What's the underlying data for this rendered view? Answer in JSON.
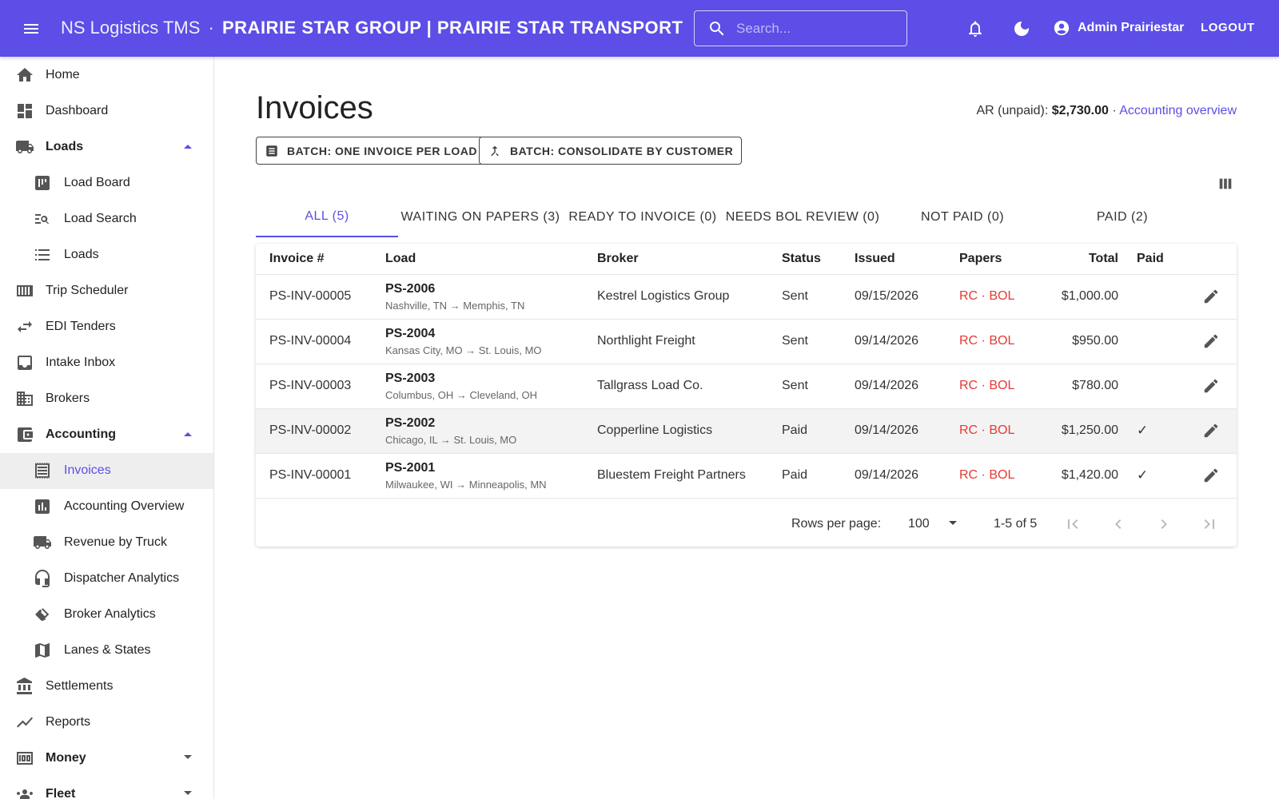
{
  "appbar": {
    "app_name": "NS Logistics TMS",
    "separator": "·",
    "org_name": "PRAIRIE STAR GROUP | PRAIRIE STAR TRANSPORT",
    "search_placeholder": "Search...",
    "user_name": "Admin Prairiestar",
    "logout_label": "LOGOUT"
  },
  "sidebar": {
    "items": [
      {
        "label": "Home",
        "icon": "home-icon"
      },
      {
        "label": "Dashboard",
        "icon": "dashboard-icon"
      },
      {
        "label": "Loads",
        "icon": "truck-icon",
        "expanded": true
      },
      {
        "label": "Load Board",
        "icon": "board-icon"
      },
      {
        "label": "Load Search",
        "icon": "search-list-icon"
      },
      {
        "label": "Loads",
        "icon": "list-icon"
      },
      {
        "label": "Trip Scheduler",
        "icon": "columns-icon"
      },
      {
        "label": "EDI Tenders",
        "icon": "swap-icon"
      },
      {
        "label": "Intake Inbox",
        "icon": "inbox-icon"
      },
      {
        "label": "Brokers",
        "icon": "building-icon"
      },
      {
        "label": "Accounting",
        "icon": "wallet-icon",
        "expanded": true
      },
      {
        "label": "Invoices",
        "icon": "receipt-icon",
        "active": true
      },
      {
        "label": "Accounting Overview",
        "icon": "bar-chart-icon"
      },
      {
        "label": "Revenue by Truck",
        "icon": "truck-icon"
      },
      {
        "label": "Dispatcher Analytics",
        "icon": "headset-icon"
      },
      {
        "label": "Broker Analytics",
        "icon": "handshake-icon"
      },
      {
        "label": "Lanes & States",
        "icon": "map-icon"
      },
      {
        "label": "Settlements",
        "icon": "bank-icon"
      },
      {
        "label": "Reports",
        "icon": "trend-icon"
      },
      {
        "label": "Money",
        "icon": "money-icon",
        "expanded": false
      },
      {
        "label": "Fleet",
        "icon": "people-icon",
        "expanded": false
      }
    ]
  },
  "main": {
    "title": "Invoices",
    "ar_label": "AR (unpaid):",
    "ar_value": "$2,730.00",
    "ar_sep": "·",
    "ar_link": "Accounting overview",
    "batch_one_label": "BATCH: ONE INVOICE PER LOAD",
    "batch_consolidate_label": "BATCH: CONSOLIDATE BY CUSTOMER",
    "tabs": [
      {
        "label": "ALL (5)",
        "active": true
      },
      {
        "label": "WAITING ON PAPERS (3)"
      },
      {
        "label": "READY TO INVOICE (0)"
      },
      {
        "label": "NEEDS BOL REVIEW (0)"
      },
      {
        "label": "NOT PAID (0)"
      },
      {
        "label": "PAID (2)"
      }
    ],
    "columns": [
      "Invoice #",
      "Load",
      "Broker",
      "Status",
      "Issued",
      "Papers",
      "Total",
      "Paid"
    ],
    "rows": [
      {
        "invoice": "PS-INV-00005",
        "load": "PS-2006",
        "route": "Nashville, TN → Memphis, TN",
        "broker": "Kestrel Logistics Group",
        "status": "Sent",
        "issued": "09/15/2026",
        "papers": "RC · BOL",
        "total": "$1,000.00",
        "paid": ""
      },
      {
        "invoice": "PS-INV-00004",
        "load": "PS-2004",
        "route": "Kansas City, MO → St. Louis, MO",
        "broker": "Northlight Freight",
        "status": "Sent",
        "issued": "09/14/2026",
        "papers": "RC · BOL",
        "total": "$950.00",
        "paid": ""
      },
      {
        "invoice": "PS-INV-00003",
        "load": "PS-2003",
        "route": "Columbus, OH → Cleveland, OH",
        "broker": "Tallgrass Load Co.",
        "status": "Sent",
        "issued": "09/14/2026",
        "papers": "RC · BOL",
        "total": "$780.00",
        "paid": ""
      },
      {
        "invoice": "PS-INV-00002",
        "load": "PS-2002",
        "route": "Chicago, IL → St. Louis, MO",
        "broker": "Copperline Logistics",
        "status": "Paid",
        "issued": "09/14/2026",
        "papers": "RC · BOL",
        "total": "$1,250.00",
        "paid": "✓"
      },
      {
        "invoice": "PS-INV-00001",
        "load": "PS-2001",
        "route": "Milwaukee, WI → Minneapolis, MN",
        "broker": "Bluestem Freight Partners",
        "status": "Paid",
        "issued": "09/14/2026",
        "papers": "RC · BOL",
        "total": "$1,420.00",
        "paid": "✓"
      }
    ],
    "pagination": {
      "rows_per_page_label": "Rows per page:",
      "rows_per_page": "100",
      "range": "1-5 of 5"
    }
  },
  "colors": {
    "primary": "#5c4ee6",
    "papers_red": "#e53935",
    "active_bg": "#eeeeee"
  }
}
